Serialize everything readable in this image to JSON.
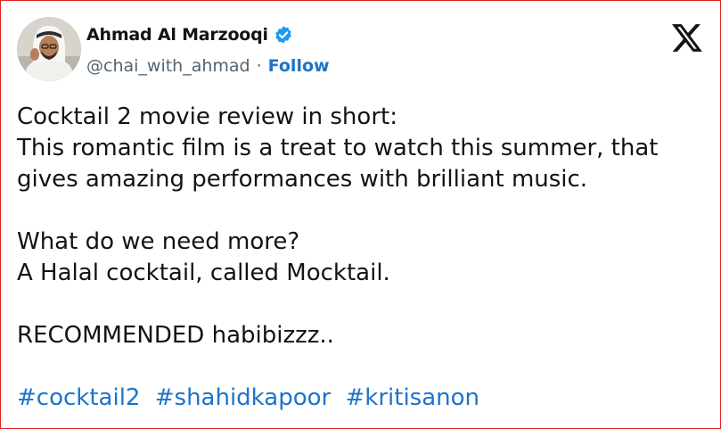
{
  "author": {
    "display_name": "Ahmad Al Marzooqi",
    "handle": "@chai_with_ahmad",
    "separator": "·",
    "follow_label": "Follow",
    "verified_color": "#1d9bf0"
  },
  "tweet": {
    "lines_block1": [
      "Cocktail 2 movie review in short:",
      "This romantic film is a treat to watch this summer, that",
      "gives amazing performances with brilliant music."
    ],
    "lines_block2": [
      "What do we need more?",
      "A Halal cocktail, called Mocktail."
    ],
    "lines_block3": [
      "RECOMMENDED habibizzz.."
    ],
    "hashtags": [
      "#cocktail2",
      "#shahidkapoor",
      "#kritisanon"
    ]
  },
  "colors": {
    "link": "#1d74c9",
    "text": "#0f1419",
    "secondary": "#536471",
    "border": "#e02020"
  }
}
